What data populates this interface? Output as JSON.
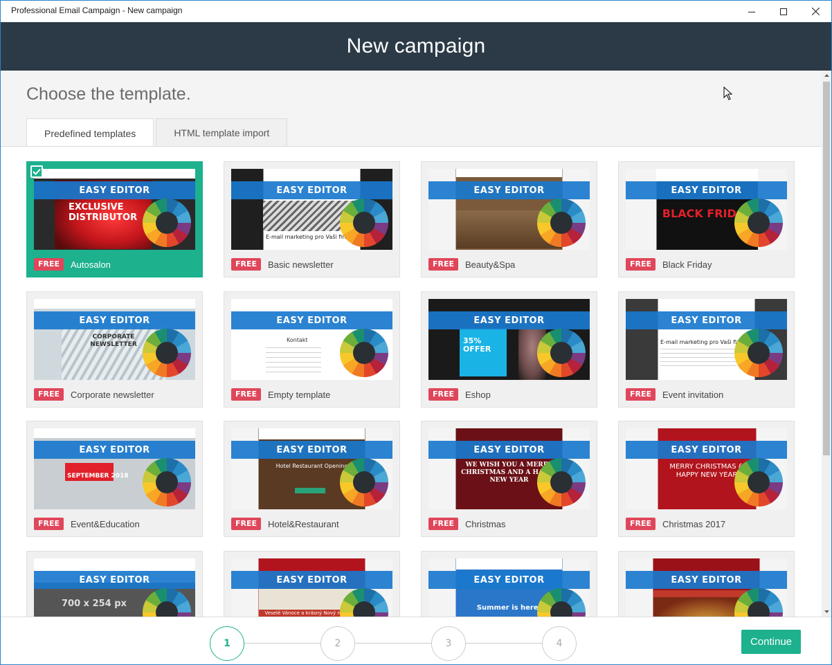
{
  "window": {
    "title": "Professional Email Campaign - New campaign"
  },
  "header": {
    "title": "New campaign"
  },
  "main": {
    "subtitle": "Choose the template.",
    "tabs": [
      {
        "label": "Predefined templates",
        "active": true
      },
      {
        "label": "HTML template import",
        "active": false
      }
    ],
    "badge_label": "FREE",
    "band_label": "EASY EDITOR",
    "templates": [
      {
        "name": "Autosalon",
        "selected": true,
        "thumb_text": "EXCLUSIVE DISTRIBUTOR"
      },
      {
        "name": "Basic newsletter",
        "selected": false,
        "thumb_text": "E-mail marketing pro Vaši firmu"
      },
      {
        "name": "Beauty&Spa",
        "selected": false,
        "thumb_text": ""
      },
      {
        "name": "Black Friday",
        "selected": false,
        "thumb_text": "BLACK FRIDAY"
      },
      {
        "name": "Corporate newsletter",
        "selected": false,
        "thumb_text": "CORPORATE NEWSLETTER"
      },
      {
        "name": "Empty template",
        "selected": false,
        "thumb_text": "Kontakt"
      },
      {
        "name": "Eshop",
        "selected": false,
        "thumb_text": "35% OFFER"
      },
      {
        "name": "Event invitation",
        "selected": false,
        "thumb_text": "E-mail marketing pro Vaši firmu"
      },
      {
        "name": "Event&Education",
        "selected": false,
        "thumb_text": "SEPTEMBER 2018"
      },
      {
        "name": "Hotel&Restaurant",
        "selected": false,
        "thumb_text": "Hotel Restaurant Opening"
      },
      {
        "name": "Christmas",
        "selected": false,
        "thumb_text": "WE WISH YOU A MERRY CHRISTMAS AND A HAPPY NEW YEAR"
      },
      {
        "name": "Christmas 2017",
        "selected": false,
        "thumb_text": "MERRY CHRISTMAS & HAPPY NEW YEAR"
      },
      {
        "name": "",
        "selected": false,
        "thumb_text": "700 x 254 px"
      },
      {
        "name": "",
        "selected": false,
        "thumb_text": "Veselé Vánoce a krásný Nový rok 2018"
      },
      {
        "name": "",
        "selected": false,
        "thumb_text": "Summer is here!"
      },
      {
        "name": "",
        "selected": false,
        "thumb_text": ""
      }
    ]
  },
  "footer": {
    "steps": [
      "1",
      "2",
      "3",
      "4"
    ],
    "active_step": 1,
    "continue_label": "Continue"
  },
  "colors": {
    "accent": "#1db18e",
    "header_bg": "#2c3a47",
    "free_badge": "#e0465a",
    "band": "#1978cd"
  }
}
